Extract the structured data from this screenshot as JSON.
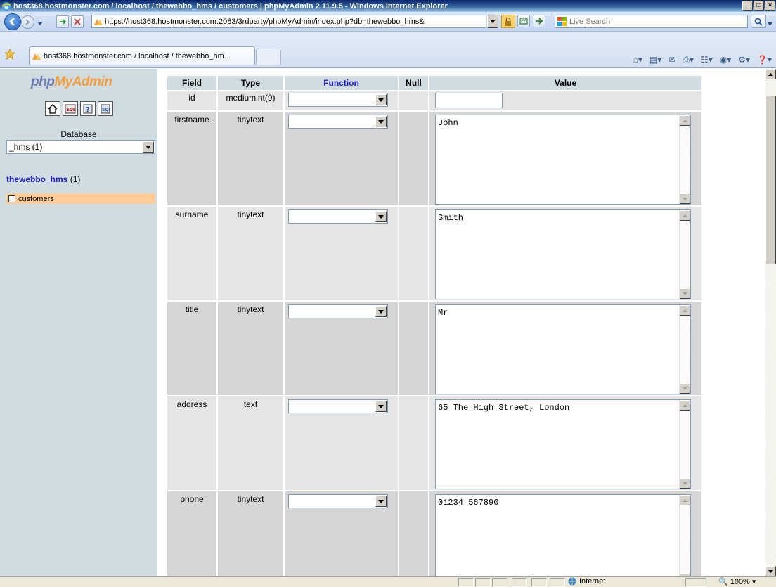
{
  "window": {
    "title": "host368.hostmonster.com / localhost / thewebbo_hms / customers | phpMyAdmin 2.11.9.5 - Windows Internet Explorer",
    "min_label": "_",
    "max_label": "□",
    "close_label": "×"
  },
  "browser": {
    "address": "https://host368.hostmonster.com:2083/3rdparty/phpMyAdmin/index.php?db=thewebbo_hms&",
    "search_placeholder": "Live Search",
    "tab_title": "host368.hostmonster.com / localhost / thewebbo_hm...",
    "status_zone": "Internet",
    "zoom": "100%"
  },
  "sidebar": {
    "logo_part1": "php",
    "logo_part2": "MyAdmin",
    "database_label": "Database",
    "database_selected": "_hms (1)",
    "db_link_name": "thewebbo_hms",
    "db_link_count": "(1)",
    "tables": [
      {
        "label": "customers"
      }
    ]
  },
  "insert_form": {
    "headers": {
      "field": "Field",
      "type": "Type",
      "function": "Function",
      "null": "Null",
      "value": "Value"
    },
    "rows": [
      {
        "field": "id",
        "type": "mediumint(9)",
        "value": ""
      },
      {
        "field": "firstname",
        "type": "tinytext",
        "value": "John"
      },
      {
        "field": "surname",
        "type": "tinytext",
        "value": "Smith"
      },
      {
        "field": "title",
        "type": "tinytext",
        "value": "Mr"
      },
      {
        "field": "address",
        "type": "text",
        "value": "65 The High Street, London"
      },
      {
        "field": "phone",
        "type": "tinytext",
        "value": "01234 567890"
      }
    ]
  },
  "colors": {
    "sidebar_bg": "#d0dce0",
    "selected_table_bg": "#ffcc99",
    "link_blue": "#2222cc"
  }
}
